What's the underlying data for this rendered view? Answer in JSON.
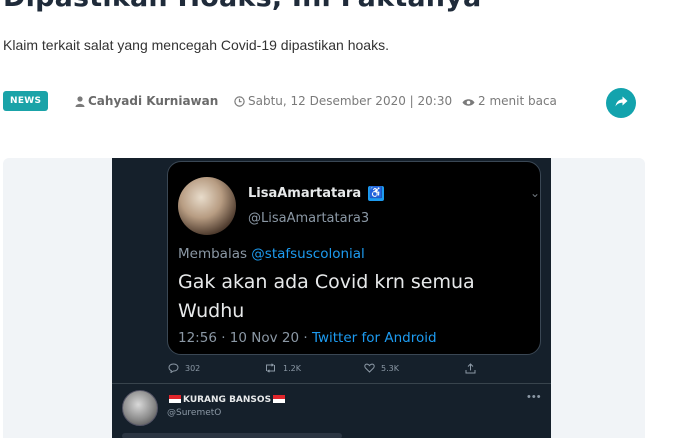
{
  "article": {
    "title": "Dipastikan Hoaks, Ini Faktanya",
    "subtitle": "Klaim terkait salat yang mencegah Covid-19 dipastikan hoaks.",
    "category": "NEWS",
    "author": "Cahyadi Kurniawan",
    "date": "Sabtu, 12 Desember 2020 | 20:30",
    "read_time": "2 menit baca",
    "accent_color": "#1aa3a8",
    "icons": {
      "author": "user-icon",
      "date": "clock-icon",
      "read_time": "eye-icon",
      "share": "share-icon"
    }
  },
  "tweet_screenshot": {
    "quoted": {
      "display_name": "LisaAmartatara",
      "handle": "@LisaAmartatara3",
      "reply_prefix": "Membalas ",
      "reply_to": "@stafsuscolonial",
      "text": "Gak akan ada Covid krn semua Wudhu",
      "timestamp": "12:56 · 10 Nov 20 · ",
      "source": "Twitter for Android"
    },
    "actions": {
      "replies": "302",
      "retweets": "1.2K",
      "likes": "5.3K"
    },
    "reply_author": {
      "display_name": "KURANG BANSOS",
      "handle": "@SuremetO"
    },
    "colors": {
      "background": "#15202b",
      "link": "#1d9bf0"
    }
  }
}
